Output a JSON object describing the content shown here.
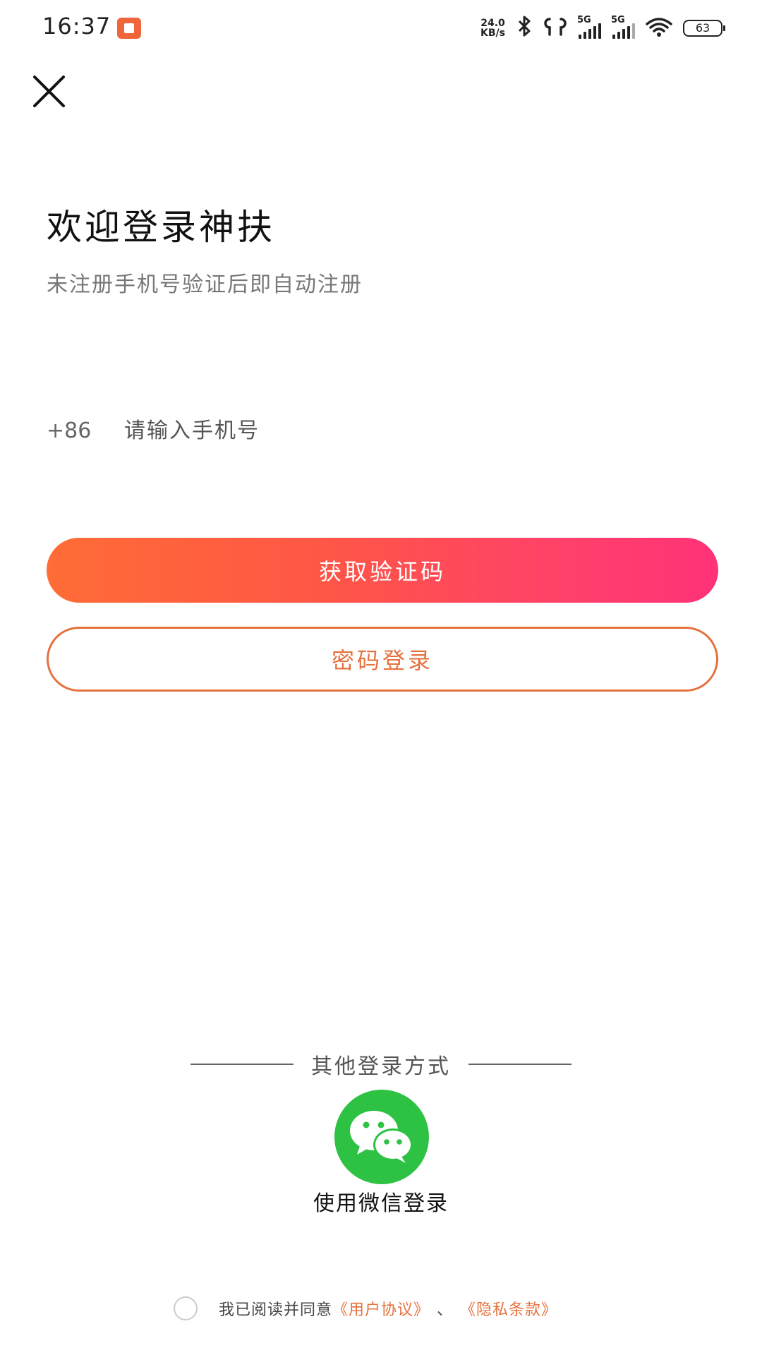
{
  "status_bar": {
    "time": "16:37",
    "net_speed_value": "24.0",
    "net_speed_unit": "KB/s",
    "signal_tag_1": "5G",
    "signal_tag_2": "5G",
    "battery": "63",
    "icons": [
      "notification-icon",
      "bluetooth-icon",
      "earbuds-icon",
      "signal-icon",
      "wifi-icon",
      "battery-icon"
    ]
  },
  "header": {
    "close_icon": "close-icon"
  },
  "main": {
    "title": "欢迎登录神扶",
    "subtitle": "未注册手机号验证后即自动注册",
    "country_code": "+86",
    "phone_placeholder": "请输入手机号",
    "get_code_label": "获取验证码",
    "password_login_label": "密码登录"
  },
  "other_login": {
    "label": "其他登录方式",
    "wechat_icon": "wechat-icon",
    "wechat_label": "使用微信登录"
  },
  "agreement": {
    "prefix": "我已阅读并同意",
    "user_agreement": "《用户协议》",
    "separator": "、",
    "privacy_policy": "《隐私条款》"
  },
  "colors": {
    "accent": "#e5713d",
    "gradient_start": "#ff6c36",
    "gradient_end": "#ff3277",
    "wechat_green": "#2dc244"
  }
}
